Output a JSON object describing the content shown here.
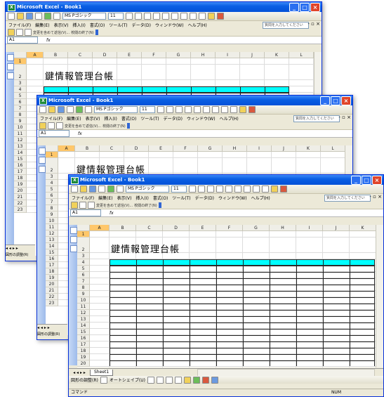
{
  "window": {
    "title": "Microsoft Excel - Book1"
  },
  "toolbar": {
    "font_name": "MS Pゴシック",
    "font_size": "11"
  },
  "menu": {
    "items": [
      "ファイル(F)",
      "編集(E)",
      "表示(V)",
      "挿入(I)",
      "書式(O)",
      "ツール(T)",
      "データ(D)",
      "ウィンドウ(W)",
      "ヘルプ(H)"
    ],
    "help_placeholder": "質問を入力してください"
  },
  "review": {
    "reply_text": "変更を含めて返信(V)...",
    "end_text": "校閲の終了(N)"
  },
  "namebox": {
    "value": "A1"
  },
  "fx_label": "fx",
  "columns": [
    "A",
    "B",
    "C",
    "D",
    "E",
    "F",
    "G",
    "H",
    "I",
    "J",
    "K",
    "L"
  ],
  "rows": [
    "1",
    "2",
    "3",
    "4",
    "5",
    "6",
    "7",
    "8",
    "9",
    "10",
    "11",
    "12",
    "13",
    "14",
    "15",
    "16",
    "17",
    "18",
    "19",
    "20",
    "21",
    "22",
    "23"
  ],
  "sheet": {
    "title": "鍵情報管理台帳",
    "band_color": "#00ffff"
  },
  "tabs": {
    "sheet1": "Sheet1"
  },
  "drawbar": {
    "draw_label": "図形の調整(R)",
    "autoshape_label": "オートシェイプ(U)"
  },
  "status": {
    "left": "コマンド",
    "num": "NUM"
  }
}
